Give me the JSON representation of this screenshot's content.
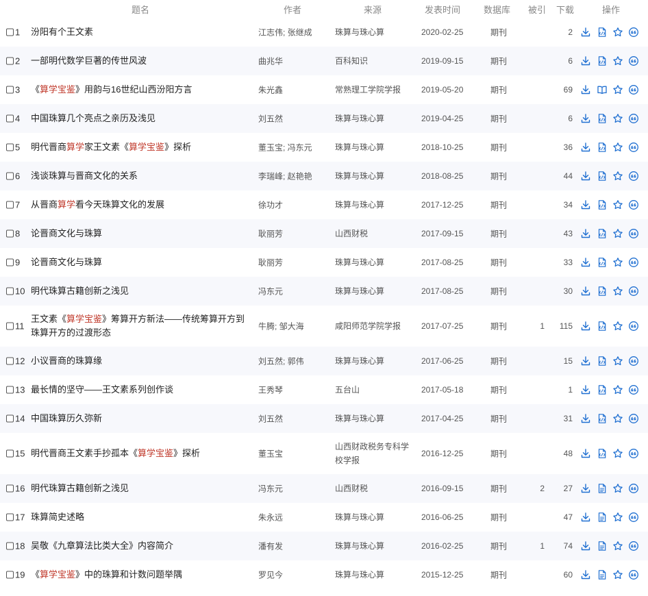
{
  "header": {
    "title": "题名",
    "author": "作者",
    "source": "来源",
    "date": "发表时间",
    "db": "数据库",
    "cited": "被引",
    "downloads": "下载",
    "ops": "操作"
  },
  "colors": {
    "highlight": "#c0392b",
    "icon": "#1f6fd1",
    "rowAlt": "#f7f8fc"
  },
  "icons": {
    "download": "download-icon",
    "html_read": "html-read-icon",
    "book_read": "book-read-icon",
    "pdf_read": "pdf-read-icon",
    "favorite": "star-icon",
    "cite": "quote-icon"
  },
  "rows": [
    {
      "idx": "1",
      "segs": [
        {
          "t": "汾阳有个王文素"
        }
      ],
      "author": "江志伟; 张继成",
      "source": "珠算与珠心算",
      "date": "2020-02-25",
      "db": "期刊",
      "cited": "",
      "downloads": "2",
      "read": "html"
    },
    {
      "idx": "2",
      "segs": [
        {
          "t": "一部明代数学巨著的传世风波"
        }
      ],
      "author": "曲兆华",
      "source": "百科知识",
      "date": "2019-09-15",
      "db": "期刊",
      "cited": "",
      "downloads": "6",
      "read": "html"
    },
    {
      "idx": "3",
      "segs": [
        {
          "t": "《"
        },
        {
          "t": "算学宝鉴",
          "hl": true
        },
        {
          "t": "》用韵与16世纪山西汾阳方言"
        }
      ],
      "author": "朱光鑫",
      "source": "常熟理工学院学报",
      "date": "2019-05-20",
      "db": "期刊",
      "cited": "",
      "downloads": "69",
      "read": "book"
    },
    {
      "idx": "4",
      "segs": [
        {
          "t": "中国珠算几个亮点之亲历及浅见"
        }
      ],
      "author": "刘五然",
      "source": "珠算与珠心算",
      "date": "2019-04-25",
      "db": "期刊",
      "cited": "",
      "downloads": "6",
      "read": "html"
    },
    {
      "idx": "5",
      "segs": [
        {
          "t": "明代晋商"
        },
        {
          "t": "算学",
          "hl": true
        },
        {
          "t": "家王文素《"
        },
        {
          "t": "算学宝鉴",
          "hl": true
        },
        {
          "t": "》探析"
        }
      ],
      "author": "董玉宝; 冯东元",
      "source": "珠算与珠心算",
      "date": "2018-10-25",
      "db": "期刊",
      "cited": "",
      "downloads": "36",
      "read": "html"
    },
    {
      "idx": "6",
      "segs": [
        {
          "t": "浅谈珠算与晋商文化的关系"
        }
      ],
      "author": "李瑞峰; 赵艳艳",
      "source": "珠算与珠心算",
      "date": "2018-08-25",
      "db": "期刊",
      "cited": "",
      "downloads": "44",
      "read": "html"
    },
    {
      "idx": "7",
      "segs": [
        {
          "t": "从晋商"
        },
        {
          "t": "算学",
          "hl": true
        },
        {
          "t": "看今天珠算文化的发展"
        }
      ],
      "author": "徐功才",
      "source": "珠算与珠心算",
      "date": "2017-12-25",
      "db": "期刊",
      "cited": "",
      "downloads": "34",
      "read": "html"
    },
    {
      "idx": "8",
      "segs": [
        {
          "t": "论晋商文化与珠算"
        }
      ],
      "author": "耿丽芳",
      "source": "山西财税",
      "date": "2017-09-15",
      "db": "期刊",
      "cited": "",
      "downloads": "43",
      "read": "html"
    },
    {
      "idx": "9",
      "segs": [
        {
          "t": "论晋商文化与珠算"
        }
      ],
      "author": "耿丽芳",
      "source": "珠算与珠心算",
      "date": "2017-08-25",
      "db": "期刊",
      "cited": "",
      "downloads": "33",
      "read": "html"
    },
    {
      "idx": "10",
      "segs": [
        {
          "t": "明代珠算古籍创新之浅见"
        }
      ],
      "author": "冯东元",
      "source": "珠算与珠心算",
      "date": "2017-08-25",
      "db": "期刊",
      "cited": "",
      "downloads": "30",
      "read": "html"
    },
    {
      "idx": "11",
      "segs": [
        {
          "t": "王文素《"
        },
        {
          "t": "算学宝鉴",
          "hl": true
        },
        {
          "t": "》筹算开方新法——传统筹算开方到珠算开方的过渡形态"
        }
      ],
      "author": "牛腾; 邹大海",
      "source": "咸阳师范学院学报",
      "date": "2017-07-25",
      "db": "期刊",
      "cited": "1",
      "downloads": "115",
      "read": "html"
    },
    {
      "idx": "12",
      "segs": [
        {
          "t": "小议晋商的珠算缘"
        }
      ],
      "author": "刘五然; 郭伟",
      "source": "珠算与珠心算",
      "date": "2017-06-25",
      "db": "期刊",
      "cited": "",
      "downloads": "15",
      "read": "html"
    },
    {
      "idx": "13",
      "segs": [
        {
          "t": "最长情的坚守——王文素系列创作谈"
        }
      ],
      "author": "王秀琴",
      "source": "五台山",
      "date": "2017-05-18",
      "db": "期刊",
      "cited": "",
      "downloads": "1",
      "read": "html"
    },
    {
      "idx": "14",
      "segs": [
        {
          "t": "中国珠算历久弥新"
        }
      ],
      "author": "刘五然",
      "source": "珠算与珠心算",
      "date": "2017-04-25",
      "db": "期刊",
      "cited": "",
      "downloads": "31",
      "read": "html"
    },
    {
      "idx": "15",
      "segs": [
        {
          "t": "明代晋商王文素手抄孤本《"
        },
        {
          "t": "算学宝鉴",
          "hl": true
        },
        {
          "t": "》探析"
        }
      ],
      "author": "董玉宝",
      "source": "山西财政税务专科学校学报",
      "date": "2016-12-25",
      "db": "期刊",
      "cited": "",
      "downloads": "48",
      "read": "html"
    },
    {
      "idx": "16",
      "segs": [
        {
          "t": "明代珠算古籍创新之浅见"
        }
      ],
      "author": "冯东元",
      "source": "山西财税",
      "date": "2016-09-15",
      "db": "期刊",
      "cited": "2",
      "downloads": "27",
      "read": "pdf"
    },
    {
      "idx": "17",
      "segs": [
        {
          "t": "珠算简史述略"
        }
      ],
      "author": "朱永远",
      "source": "珠算与珠心算",
      "date": "2016-06-25",
      "db": "期刊",
      "cited": "",
      "downloads": "47",
      "read": "pdf"
    },
    {
      "idx": "18",
      "segs": [
        {
          "t": "吴敬《九章算法比类大全》内容简介"
        }
      ],
      "author": "潘有发",
      "source": "珠算与珠心算",
      "date": "2016-02-25",
      "db": "期刊",
      "cited": "1",
      "downloads": "74",
      "read": "pdf"
    },
    {
      "idx": "19",
      "segs": [
        {
          "t": "《"
        },
        {
          "t": "算学宝鉴",
          "hl": true
        },
        {
          "t": "》中的珠算和计数问题举隅"
        }
      ],
      "author": "罗见今",
      "source": "珠算与珠心算",
      "date": "2015-12-25",
      "db": "期刊",
      "cited": "",
      "downloads": "60",
      "read": "pdf"
    }
  ]
}
